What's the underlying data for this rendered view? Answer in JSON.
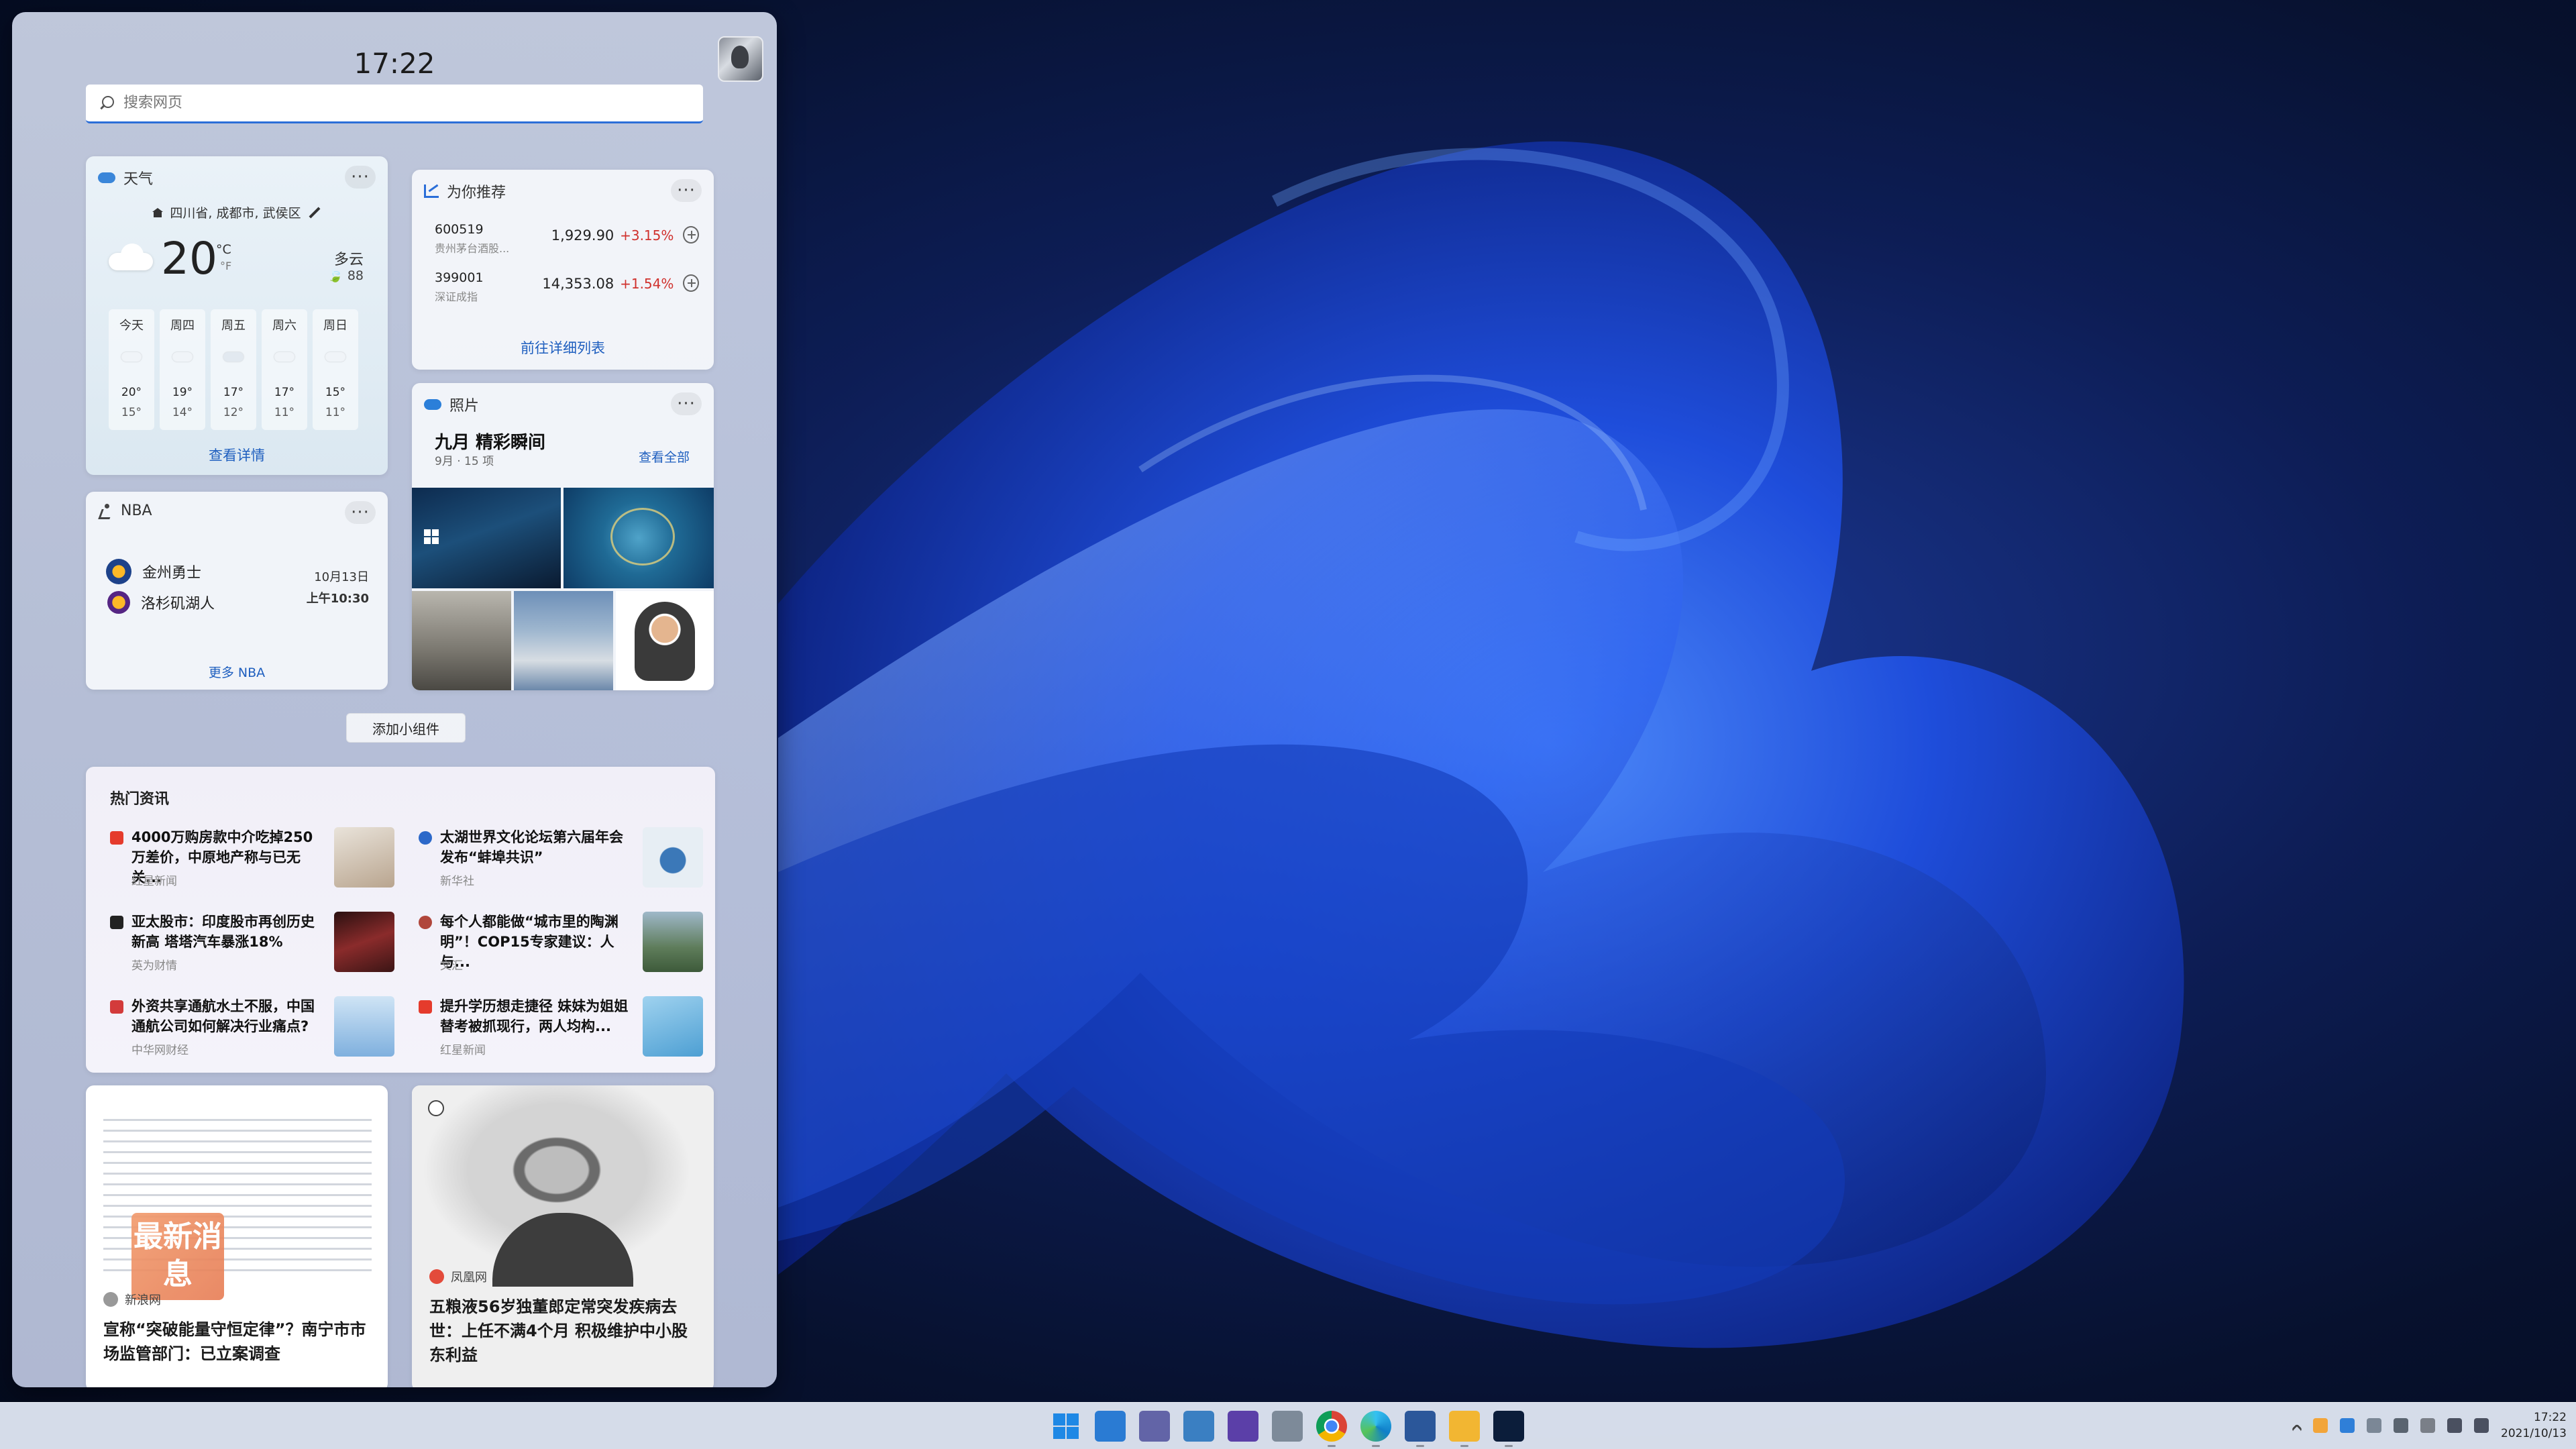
{
  "widgets": {
    "time": "17:22",
    "search": {
      "placeholder": "搜索网页"
    },
    "weather": {
      "title": "天气",
      "location": "四川省, 成都市, 武侯区",
      "temp": "20",
      "unit_c": "°C",
      "unit_f": "°F",
      "condition": "多云",
      "aqi": "88",
      "forecast": [
        {
          "day": "今天",
          "hi": "20°",
          "lo": "15°",
          "icon": "cloud-icon"
        },
        {
          "day": "周四",
          "hi": "19°",
          "lo": "14°",
          "icon": "partly-sunny-icon"
        },
        {
          "day": "周五",
          "hi": "17°",
          "lo": "12°",
          "icon": "rain-icon"
        },
        {
          "day": "周六",
          "hi": "17°",
          "lo": "11°",
          "icon": "partly-sunny-icon"
        },
        {
          "day": "周日",
          "hi": "15°",
          "lo": "11°",
          "icon": "partly-sunny-icon"
        }
      ],
      "details_link": "查看详情"
    },
    "stocks": {
      "title": "为你推荐",
      "rows": [
        {
          "code": "600519",
          "name": "贵州茅台酒股...",
          "price": "1,929.90",
          "change": "+3.15%"
        },
        {
          "code": "399001",
          "name": "深证成指",
          "price": "14,353.08",
          "change": "+1.54%"
        }
      ],
      "link": "前往详细列表"
    },
    "nba": {
      "title": "NBA",
      "team1": "金州勇士",
      "team2": "洛杉矶湖人",
      "date": "10月13日",
      "time": "上午10:30",
      "link": "更多 NBA"
    },
    "photos": {
      "title": "照片",
      "album": "九月 精彩瞬间",
      "meta": "9月 · 15 项",
      "view_all": "查看全部"
    },
    "add_widget": "添加小组件",
    "news": {
      "title": "热门资讯",
      "items": [
        {
          "headline": "4000万购房款中介吃掉250万差价，中原地产称与已无关...",
          "source": "红星新闻",
          "src_color": "#e53b2c",
          "thumb_color": "#c9b8a4"
        },
        {
          "headline": "太湖世界文化论坛第六届年会发布“蚌埠共识”",
          "source": "新华社",
          "src_color": "#2c68c9",
          "thumb_color": "#6a9ac2"
        },
        {
          "headline": "亚太股市：印度股市再创历史新高 塔塔汽车暴涨18%",
          "source": "英为财情",
          "src_color": "#222222",
          "thumb_color": "#7a2a2a"
        },
        {
          "headline": "每个人都能做“城市里的陶渊明”！COP15专家建议：人与...",
          "source": "文汇",
          "src_color": "#b0463b",
          "thumb_color": "#5e7c5a"
        },
        {
          "headline": "外资共享通航水土不服，中国通航公司如何解决行业痛点?",
          "source": "中华网财经",
          "src_color": "#d33b3b",
          "thumb_color": "#5f96c8"
        },
        {
          "headline": "提升学历想走捷径 妹妹为姐姐替考被抓现行，两人均构...",
          "source": "红星新闻",
          "src_color": "#e53b2c",
          "thumb_color": "#7fb6d9"
        }
      ]
    },
    "story1": {
      "badge": "最新消息",
      "source": "新浪网",
      "headline": "宣称“突破能量守恒定律”？南宁市市场监管部门：已立案调查"
    },
    "story2": {
      "source": "凤凰网",
      "headline": "五粮液56岁独董郎定常突发疾病去世：上任不满4个月 积极维护中小股东利益"
    }
  },
  "taskbar": {
    "apps": [
      {
        "name": "start-icon",
        "color": "#1e88e5"
      },
      {
        "name": "widgets-icon",
        "color": "#2a7bd3"
      },
      {
        "name": "chat-icon",
        "color": "#6264a7"
      },
      {
        "name": "desktop-icon",
        "color": "#3a7fc2"
      },
      {
        "name": "video-icon",
        "color": "#5b3fa8"
      },
      {
        "name": "notepad-icon",
        "color": "#7d8a99"
      },
      {
        "name": "chrome-icon",
        "color": "#db4437"
      },
      {
        "name": "edge-icon",
        "color": "#0f7fc9"
      },
      {
        "name": "word-icon",
        "color": "#2b579a"
      },
      {
        "name": "explorer-icon",
        "color": "#f2b632"
      },
      {
        "name": "photoshop-icon",
        "color": "#0b1d3a"
      }
    ],
    "clock_time": "17:22",
    "clock_date": "2021/10/13"
  }
}
